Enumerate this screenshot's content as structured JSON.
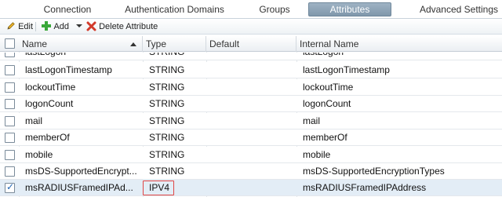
{
  "tabs": [
    {
      "label": "Connection",
      "active": false
    },
    {
      "label": "Authentication Domains",
      "active": false
    },
    {
      "label": "Groups",
      "active": false
    },
    {
      "label": "Attributes",
      "active": true
    },
    {
      "label": "Advanced Settings",
      "active": false
    }
  ],
  "toolbar": {
    "edit_label": "Edit",
    "add_label": "Add",
    "delete_label": "Delete Attribute"
  },
  "grid": {
    "columns": [
      "Name",
      "Type",
      "Default",
      "Internal Name"
    ],
    "sorted_column": "Name",
    "sort_direction": "ascending",
    "rows": [
      {
        "name": "lastLogon",
        "type": "STRING",
        "default": "",
        "internal": "lastLogon",
        "checked": false
      },
      {
        "name": "lastLogonTimestamp",
        "type": "STRING",
        "default": "",
        "internal": "lastLogonTimestamp",
        "checked": false
      },
      {
        "name": "lockoutTime",
        "type": "STRING",
        "default": "",
        "internal": "lockoutTime",
        "checked": false
      },
      {
        "name": "logonCount",
        "type": "STRING",
        "default": "",
        "internal": "logonCount",
        "checked": false
      },
      {
        "name": "mail",
        "type": "STRING",
        "default": "",
        "internal": "mail",
        "checked": false
      },
      {
        "name": "memberOf",
        "type": "STRING",
        "default": "",
        "internal": "memberOf",
        "checked": false
      },
      {
        "name": "mobile",
        "type": "STRING",
        "default": "",
        "internal": "mobile",
        "checked": false
      },
      {
        "name": "msDS-SupportedEncrypt...",
        "type": "STRING",
        "default": "",
        "internal": "msDS-SupportedEncryptionTypes",
        "checked": false
      },
      {
        "name": "msRADIUSFramedIPAd...",
        "type": "IPV4",
        "default": "",
        "internal": "msRADIUSFramedIPAddress",
        "checked": true
      }
    ]
  },
  "colors": {
    "active_tab": "#8aa0b4",
    "selected_row": "#e3edf6",
    "highlight_border": "#e04545",
    "add_icon": "#3aa83a",
    "delete_icon": "#d23a2a"
  }
}
